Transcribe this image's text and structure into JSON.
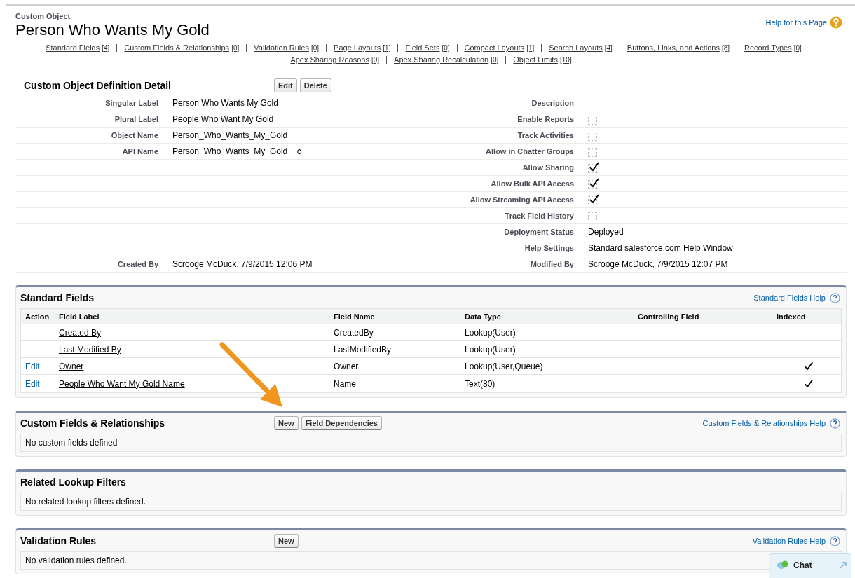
{
  "header": {
    "object_type": "Custom Object",
    "title": "Person Who Wants My Gold",
    "help_link": "Help for this Page"
  },
  "nav_rows": [
    {
      "links": [
        {
          "label": "Standard Fields",
          "count": "[4]"
        },
        {
          "label": "Custom Fields & Relationships",
          "count": "[0]"
        },
        {
          "label": "Validation Rules",
          "count": "[0]"
        },
        {
          "label": "Page Layouts",
          "count": "[1]"
        },
        {
          "label": "Field Sets",
          "count": "[0]"
        },
        {
          "label": "Compact Layouts",
          "count": "[1]"
        },
        {
          "label": "Search Layouts",
          "count": "[4]"
        },
        {
          "label": "Buttons, Links, and Actions",
          "count": "[8]"
        },
        {
          "label": "Record Types",
          "count": "[0]"
        }
      ],
      "trailing_separator": true
    },
    {
      "links": [
        {
          "label": "Apex Sharing Reasons",
          "count": "[0]"
        },
        {
          "label": "Apex Sharing Recalculation",
          "count": "[0]"
        },
        {
          "label": "Object Limits",
          "count": "[10]"
        }
      ],
      "trailing_separator": false
    }
  ],
  "detail": {
    "title": "Custom Object Definition Detail",
    "buttons": [
      "Edit",
      "Delete"
    ],
    "rows": [
      {
        "left": {
          "kind": "text",
          "label": "Singular Label",
          "value": "Person Who Wants My Gold"
        },
        "right": {
          "kind": "text",
          "label": "Description"
        }
      },
      {
        "left": {
          "kind": "text",
          "label": "Plural Label",
          "value": "People Who Want My Gold"
        },
        "right": {
          "kind": "checkbox",
          "label": "Enable Reports",
          "checked": false
        }
      },
      {
        "left": {
          "kind": "text",
          "label": "Object Name",
          "value": "Person_Who_Wants_My_Gold"
        },
        "right": {
          "kind": "checkbox",
          "label": "Track Activities",
          "checked": false
        }
      },
      {
        "left": {
          "kind": "text",
          "label": "API Name",
          "value": "Person_Who_Wants_My_Gold__c"
        },
        "right": {
          "kind": "checkbox",
          "label": "Allow in Chatter Groups",
          "checked": false
        }
      },
      {
        "right": {
          "kind": "checkbox",
          "label": "Allow Sharing",
          "checked": true
        }
      },
      {
        "right": {
          "kind": "checkbox",
          "label": "Allow Bulk API Access",
          "checked": true
        }
      },
      {
        "right": {
          "kind": "checkbox",
          "label": "Allow Streaming API Access",
          "checked": true
        }
      },
      {
        "right": {
          "kind": "checkbox",
          "label": "Track Field History",
          "checked": false
        }
      },
      {
        "right": {
          "kind": "text",
          "label": "Deployment Status",
          "value": "Deployed"
        }
      },
      {
        "right": {
          "kind": "text",
          "label": "Help Settings",
          "value": "Standard salesforce.com Help Window"
        }
      },
      {
        "left": {
          "kind": "user",
          "label": "Created By",
          "user": "Scrooge McDuck",
          "value": ", 7/9/2015 12:06 PM"
        },
        "right": {
          "kind": "user",
          "label": "Modified By",
          "user": "Scrooge McDuck",
          "value": ", 7/9/2015 12:07 PM"
        }
      }
    ]
  },
  "standard_fields": {
    "title": "Standard Fields",
    "help_link": "Standard Fields Help",
    "columns": [
      "Action",
      "Field Label",
      "Field Name",
      "Data Type",
      "Controlling Field",
      "Indexed"
    ],
    "rows": [
      {
        "field_label": "Created By",
        "field_name": "CreatedBy",
        "data_type": "Lookup(User)",
        "indexed": false
      },
      {
        "field_label": "Last Modified By",
        "field_name": "LastModifiedBy",
        "data_type": "Lookup(User)",
        "indexed": false
      },
      {
        "action": "Edit",
        "field_label": "Owner",
        "field_name": "Owner",
        "data_type": "Lookup(User,Queue)",
        "indexed": true
      },
      {
        "action": "Edit",
        "field_label": "People Who Want My Gold Name",
        "field_name": "Name",
        "data_type": "Text(80)",
        "indexed": true
      }
    ]
  },
  "sections": [
    {
      "title": "Custom Fields & Relationships",
      "buttons": [
        "New",
        "Field Dependencies"
      ],
      "help_link": "Custom Fields & Relationships Help",
      "message": "No custom fields defined"
    },
    {
      "title": "Related Lookup Filters",
      "message": "No related lookup filters defined."
    },
    {
      "title": "Validation Rules",
      "buttons": [
        "New"
      ],
      "help_link": "Validation Rules Help",
      "message": "No validation rules defined."
    }
  ],
  "chat": {
    "label": "Chat"
  }
}
